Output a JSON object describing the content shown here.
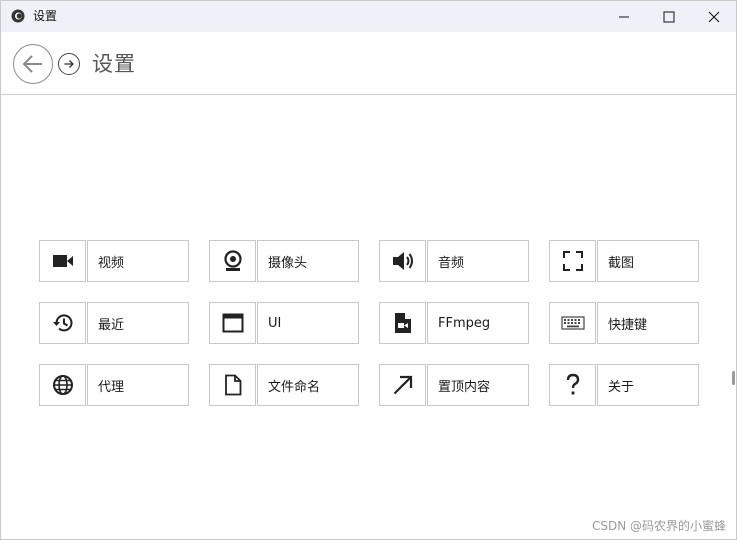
{
  "window": {
    "title": "设置",
    "icon": "app-circle-icon"
  },
  "nav": {
    "back_icon": "back-arrow-icon",
    "forward_icon": "forward-arrow-icon",
    "title": "设置"
  },
  "tiles": [
    {
      "label": "视频",
      "icon": "video-camera-icon"
    },
    {
      "label": "摄像头",
      "icon": "webcam-icon"
    },
    {
      "label": "音频",
      "icon": "speaker-icon"
    },
    {
      "label": "截图",
      "icon": "screenshot-frame-icon"
    },
    {
      "label": "最近",
      "icon": "history-icon"
    },
    {
      "label": "UI",
      "icon": "window-icon"
    },
    {
      "label": "FFmpeg",
      "icon": "video-file-icon"
    },
    {
      "label": "快捷键",
      "icon": "keyboard-icon"
    },
    {
      "label": "代理",
      "icon": "globe-icon"
    },
    {
      "label": "文件命名",
      "icon": "document-icon"
    },
    {
      "label": "置顶内容",
      "icon": "diagonal-arrow-icon"
    },
    {
      "label": "关于",
      "icon": "question-mark-icon"
    }
  ],
  "watermark": "CSDN @码农界的小蜜蜂"
}
